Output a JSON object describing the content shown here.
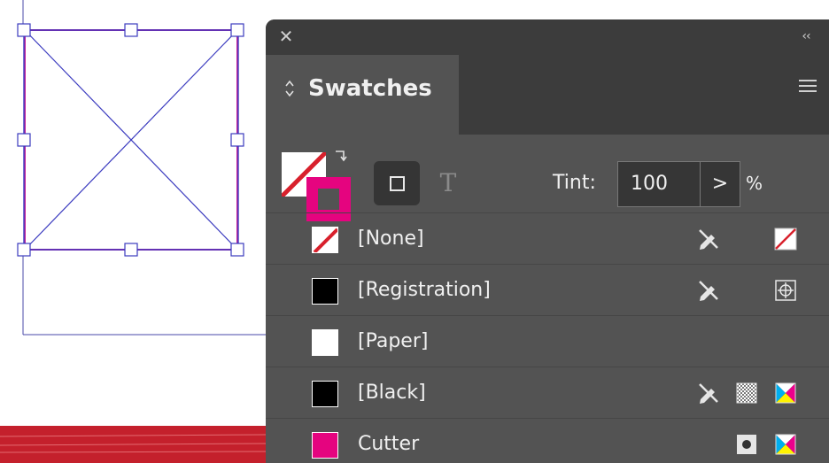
{
  "colors": {
    "panel_bg": "#535353",
    "panel_header_bg": "#3c3c3c",
    "magenta": "#e5047f",
    "frame_stroke": "#3b3bbf",
    "red_stroke": "#c4202c"
  },
  "panel": {
    "close_icon": "close-icon",
    "collapse_label": "‹‹",
    "tab_label": "Swatches",
    "menu_icon": "hamburger-menu-icon"
  },
  "controls": {
    "tint_label": "Tint:",
    "tint_value": "100",
    "tint_step_label": ">",
    "tint_unit": "%",
    "text_toggle_label": "T"
  },
  "swatches": [
    {
      "name": "[None]",
      "chip": "none",
      "icons": [
        "not-editable-pencil-icon",
        "none-color-icon"
      ]
    },
    {
      "name": "[Registration]",
      "chip": "#000000",
      "icons": [
        "not-editable-pencil-icon",
        "registration-icon"
      ]
    },
    {
      "name": "[Paper]",
      "chip": "#ffffff",
      "icons": []
    },
    {
      "name": "[Black]",
      "chip": "#000000",
      "icons": [
        "not-editable-pencil-icon",
        "spot-pattern-icon",
        "cmyk-icon"
      ]
    },
    {
      "name": "Cutter",
      "chip": "#e5047f",
      "icons": [
        "spot-color-icon",
        "cmyk-icon"
      ]
    }
  ]
}
